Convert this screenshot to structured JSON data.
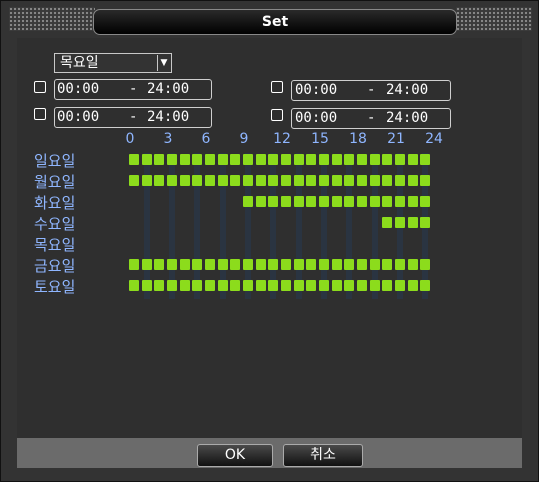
{
  "window": {
    "title": "Set"
  },
  "day_select": {
    "value": "목요일"
  },
  "time_periods": [
    {
      "checked": false,
      "start": "00:00",
      "sep": "-",
      "end": "24:00"
    },
    {
      "checked": false,
      "start": "00:00",
      "sep": "-",
      "end": "24:00"
    },
    {
      "checked": false,
      "start": "00:00",
      "sep": "-",
      "end": "24:00"
    },
    {
      "checked": false,
      "start": "00:00",
      "sep": "-",
      "end": "24:00"
    }
  ],
  "hour_labels": [
    "0",
    "3",
    "6",
    "9",
    "12",
    "15",
    "18",
    "21",
    "24"
  ],
  "days": [
    {
      "label": "일요일",
      "active_from": 0,
      "active_to": 24
    },
    {
      "label": "월요일",
      "active_from": 0,
      "active_to": 24
    },
    {
      "label": "화요일",
      "active_from": 9,
      "active_to": 24
    },
    {
      "label": "수요일",
      "active_from": 20,
      "active_to": 24
    },
    {
      "label": "목요일",
      "active_from": 0,
      "active_to": 0
    },
    {
      "label": "금요일",
      "active_from": 0,
      "active_to": 24
    },
    {
      "label": "토요일",
      "active_from": 0,
      "active_to": 24
    }
  ],
  "buttons": {
    "ok": "OK",
    "cancel": "취소"
  },
  "colors": {
    "active_cell": "#8cdc1c",
    "label": "#8fb6ff",
    "grid_col": "#2a3441"
  }
}
